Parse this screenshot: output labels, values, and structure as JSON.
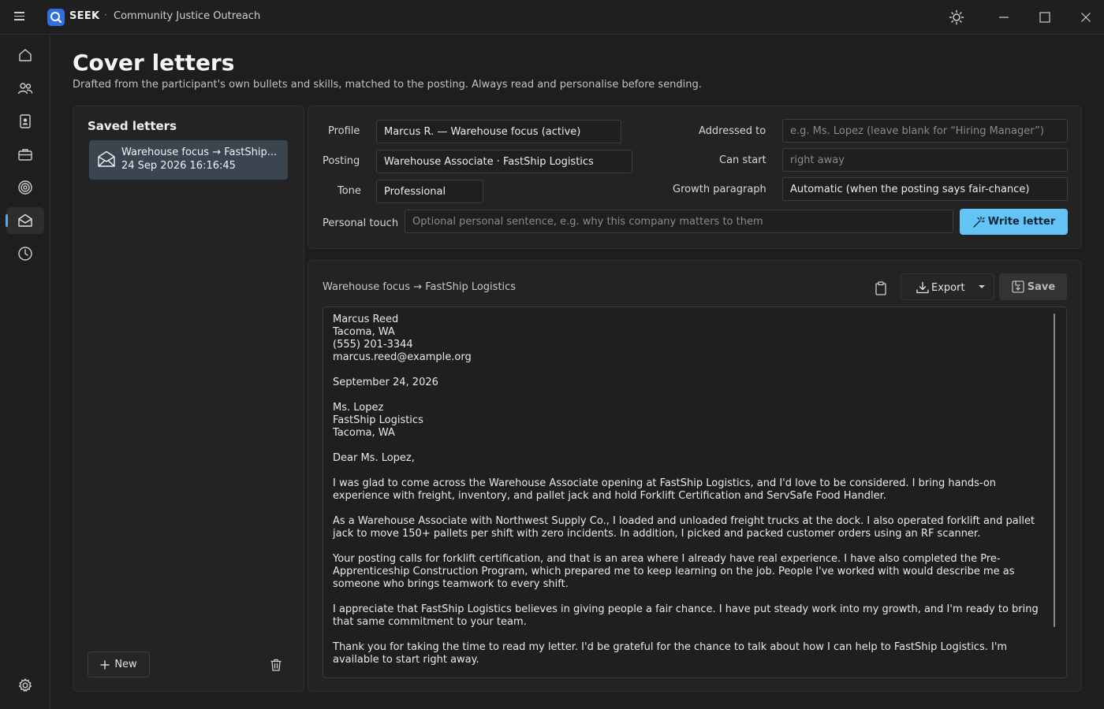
{
  "app": {
    "brand": "SEEK",
    "separator": "·",
    "org": "Community Justice Outreach"
  },
  "nav": [
    {
      "icon": "home-icon"
    },
    {
      "icon": "people-icon"
    },
    {
      "icon": "profile-document-icon"
    },
    {
      "icon": "briefcase-icon"
    },
    {
      "icon": "target-icon"
    },
    {
      "icon": "mail-icon",
      "active": true
    },
    {
      "icon": "history-icon"
    },
    {
      "icon": "gear-icon"
    }
  ],
  "page": {
    "title": "Cover letters",
    "subtitle": "Drafted from the participant's own bullets and skills, matched to the posting. Always read and personalise before sending."
  },
  "saved": {
    "title": "Saved letters",
    "items": [
      {
        "title": "Warehouse focus → FastShip...",
        "date": "24 Sep 2026 16:16:45"
      }
    ],
    "new_label": "New"
  },
  "form": {
    "profile_label": "Profile",
    "profile_value": "Marcus R. — Warehouse focus  (active)",
    "posting_label": "Posting",
    "posting_value": "Warehouse Associate · FastShip Logistics",
    "tone_label": "Tone",
    "tone_value": "Professional",
    "addressed_label": "Addressed to",
    "addressed_placeholder": "e.g. Ms. Lopez (leave blank for “Hiring Manager”)",
    "canstart_label": "Can start",
    "canstart_placeholder": "right away",
    "growth_label": "Growth paragraph",
    "growth_value": "Automatic (when the posting says fair-chance)",
    "personal_label": "Personal touch",
    "personal_placeholder": "Optional personal sentence, e.g. why this company matters to them",
    "write_label": "Write letter"
  },
  "letter": {
    "title": "Warehouse focus → FastShip Logistics",
    "export_label": "Export",
    "save_label": "Save",
    "paragraphs": [
      "Marcus Reed\nTacoma, WA\n(555) 201-3344\nmarcus.reed@example.org",
      "September 24, 2026",
      "Ms. Lopez\nFastShip Logistics\nTacoma, WA",
      "Dear Ms. Lopez,",
      "I was glad to come across the Warehouse Associate opening at FastShip Logistics, and I'd love to be considered. I bring hands-on experience with freight, inventory, and pallet jack and hold Forklift Certification and ServSafe Food Handler.",
      "As a Warehouse Associate with Northwest Supply Co., I loaded and unloaded freight trucks at the dock. I also operated forklift and pallet jack to move 150+ pallets per shift with zero incidents. In addition, I picked and packed customer orders using an RF scanner.",
      "Your posting calls for forklift certification, and that is an area where I already have real experience. I have also completed the Pre-Apprenticeship Construction Program, which prepared me to keep learning on the job. People I've worked with would describe me as someone who brings teamwork to every shift.",
      "I appreciate that FastShip Logistics believes in giving people a fair chance. I have put steady work into my growth, and I'm ready to bring that same commitment to your team.",
      "Thank you for taking the time to read my letter. I'd be grateful for the chance to talk about how I can help to FastShip Logistics. I'm available to start right away."
    ]
  },
  "colors": {
    "accent": "#63c4f5",
    "selected": "#3a4550",
    "nav_indicator": "#5aa9e6"
  }
}
